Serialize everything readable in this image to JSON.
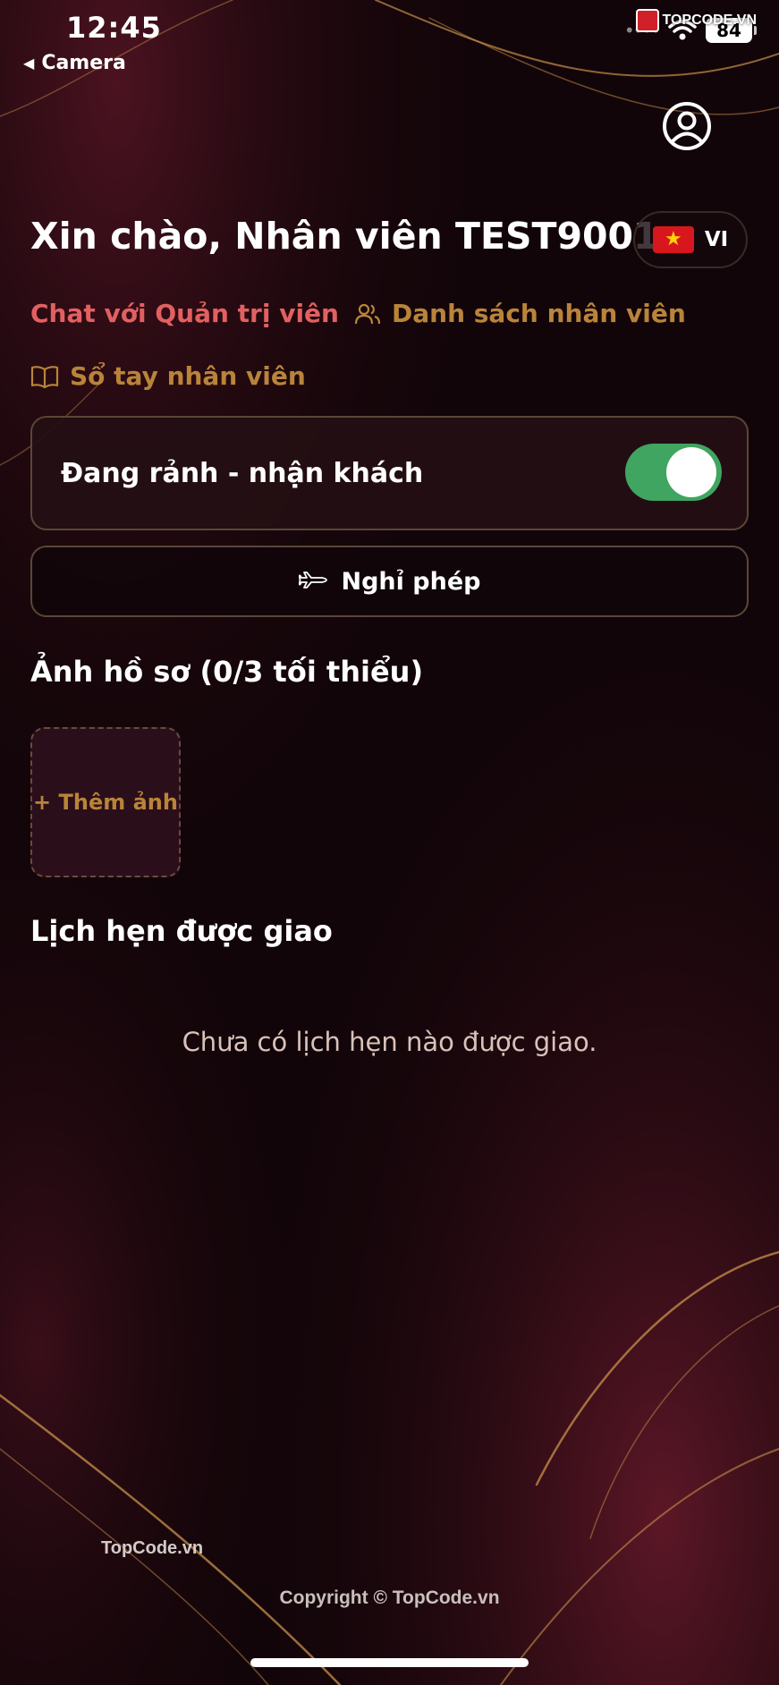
{
  "status_bar": {
    "time": "12:45",
    "back_label": "Camera",
    "battery": "84",
    "watermark": "TOPCODE.VN"
  },
  "header": {
    "greeting": "Xin chào, Nhân viên TEST9001",
    "language": {
      "flag": "★",
      "code": "VI"
    }
  },
  "nav": {
    "chat_admin": "Chat với Quản trị viên",
    "staff_list": "Danh sách nhân viên",
    "handbook": "Sổ tay nhân viên"
  },
  "availability": {
    "label": "Đang rảnh - nhận khách",
    "enabled": true
  },
  "leave_button": "Nghỉ phép",
  "photos": {
    "title": "Ảnh hồ sơ (0/3 tối thiểu)",
    "add_label": "+ Thêm ảnh"
  },
  "appointments": {
    "title": "Lịch hẹn được giao",
    "empty_message": "Chưa có lịch hẹn nào được giao."
  },
  "footer": {
    "watermark": "TopCode.vn",
    "copyright": "Copyright © TopCode.vn"
  },
  "colors": {
    "background": "#120509",
    "accent_red": "#e36060",
    "accent_gold": "#b9843a",
    "toggle_on": "#3fa560"
  }
}
